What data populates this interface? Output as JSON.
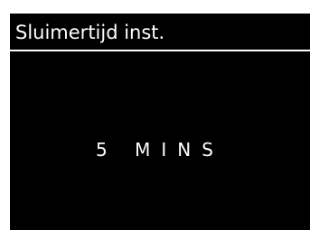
{
  "screen": {
    "title": "Sluimertijd inst.",
    "value": "5 MINS",
    "colors": {
      "background": "#000000",
      "text": "#ffffff",
      "divider": "#ffffff"
    }
  }
}
